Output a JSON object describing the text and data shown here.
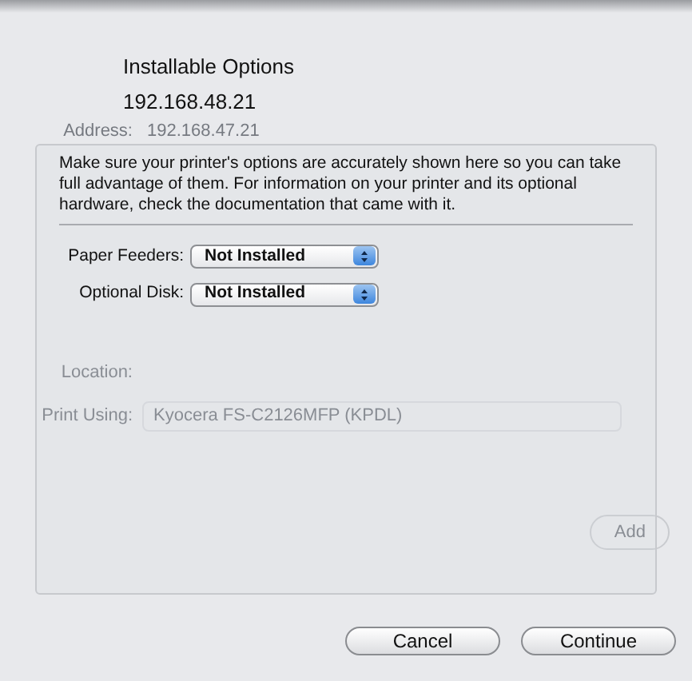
{
  "background_window": {
    "address_label": "Address:",
    "address_value": "192.168.47.21",
    "location_label": "Location:",
    "print_using_label": "Print Using:",
    "print_using_value": "Kyocera FS-C2126MFP (KPDL)",
    "add_button": "Add"
  },
  "sheet": {
    "title": "Installable Options",
    "subtitle": "192.168.48.21",
    "description": "Make sure your printer's options are accurately shown here so you can take full advantage of them.  For information on your printer and its optional hardware, check the documentation that came with it.",
    "options": [
      {
        "label": "Paper Feeders:",
        "value": "Not Installed"
      },
      {
        "label": "Optional Disk:",
        "value": "Not Installed"
      }
    ],
    "buttons": [
      "Cancel",
      "Continue"
    ]
  }
}
